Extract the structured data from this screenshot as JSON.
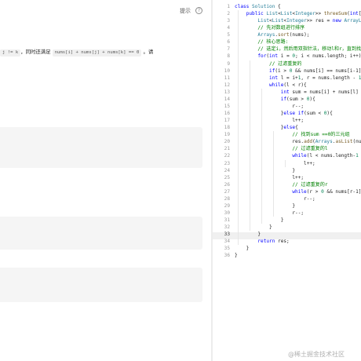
{
  "left": {
    "submit_label": "提示",
    "help_icon": "?",
    "desc_prefix": "j != k",
    "desc_middle": "，同时还满足",
    "desc_expr": "nums[i] + nums[j] + nums[k] == 0",
    "desc_suffix": "。请"
  },
  "editor": {
    "line_numbers": [
      "1",
      "2",
      "3",
      "4",
      "5",
      "6",
      "7",
      "8",
      "9",
      "10",
      "11",
      "12",
      "13",
      "14",
      "15",
      "16",
      "17",
      "18",
      "19",
      "20",
      "21",
      "22",
      "23",
      "24",
      "25",
      "26",
      "27",
      "28",
      "29",
      "30",
      "31",
      "32",
      "33",
      "34",
      "35",
      "36"
    ],
    "active_line": "33",
    "lines": [
      [
        {
          "t": "kw",
          "v": "class "
        },
        {
          "t": "type",
          "v": "Solution"
        },
        {
          "t": "pl",
          "v": " {"
        }
      ],
      [
        {
          "t": "pl",
          "v": "    "
        },
        {
          "t": "kw",
          "v": "public "
        },
        {
          "t": "type",
          "v": "List"
        },
        {
          "t": "pl",
          "v": "<"
        },
        {
          "t": "type",
          "v": "List"
        },
        {
          "t": "pl",
          "v": "<"
        },
        {
          "t": "type",
          "v": "Integer"
        },
        {
          "t": "pl",
          "v": ">> "
        },
        {
          "t": "fn",
          "v": "threeSum"
        },
        {
          "t": "pl",
          "v": "("
        },
        {
          "t": "kw",
          "v": "int"
        },
        {
          "t": "pl",
          "v": "[] nums) {"
        }
      ],
      [
        {
          "t": "pl",
          "v": "        "
        },
        {
          "t": "type",
          "v": "List"
        },
        {
          "t": "pl",
          "v": "<"
        },
        {
          "t": "type",
          "v": "List"
        },
        {
          "t": "pl",
          "v": "<"
        },
        {
          "t": "type",
          "v": "Integer"
        },
        {
          "t": "pl",
          "v": ">> res = "
        },
        {
          "t": "kw",
          "v": "new "
        },
        {
          "t": "type",
          "v": "ArrayList"
        },
        {
          "t": "pl",
          "v": "<>();"
        }
      ],
      [
        {
          "t": "pl",
          "v": "        "
        },
        {
          "t": "cm",
          "v": "// 先对数组进行排序"
        }
      ],
      [
        {
          "t": "pl",
          "v": "        "
        },
        {
          "t": "type",
          "v": "Arrays"
        },
        {
          "t": "pl",
          "v": "."
        },
        {
          "t": "fn",
          "v": "sort"
        },
        {
          "t": "pl",
          "v": "(nums);"
        }
      ],
      [
        {
          "t": "pl",
          "v": "        "
        },
        {
          "t": "cm",
          "v": "// 核心思路:"
        }
      ],
      [
        {
          "t": "pl",
          "v": "        "
        },
        {
          "t": "cm",
          "v": "// 选定i，然后用双指针法，移动l和r，直到找到"
        }
      ],
      [
        {
          "t": "pl",
          "v": "        "
        },
        {
          "t": "kw",
          "v": "for"
        },
        {
          "t": "pl",
          "v": "("
        },
        {
          "t": "kw",
          "v": "int "
        },
        {
          "t": "pl",
          "v": "i = "
        },
        {
          "t": "num",
          "v": "0"
        },
        {
          "t": "pl",
          "v": "; i < nums.length; i++){"
        }
      ],
      [
        {
          "t": "pl",
          "v": "            "
        },
        {
          "t": "cm",
          "v": "// 过滤重复的"
        }
      ],
      [
        {
          "t": "pl",
          "v": "            "
        },
        {
          "t": "kw",
          "v": "if"
        },
        {
          "t": "pl",
          "v": "(i > "
        },
        {
          "t": "num",
          "v": "0"
        },
        {
          "t": "pl",
          "v": " && nums[i] == nums[i-1]) "
        },
        {
          "t": "kw",
          "v": "continue"
        },
        {
          "t": "pl",
          "v": ";"
        }
      ],
      [
        {
          "t": "pl",
          "v": "            "
        },
        {
          "t": "kw",
          "v": "int "
        },
        {
          "t": "pl",
          "v": "l = i+"
        },
        {
          "t": "num",
          "v": "1"
        },
        {
          "t": "pl",
          "v": ", r = nums.length - "
        },
        {
          "t": "num",
          "v": "1"
        },
        {
          "t": "pl",
          "v": ";"
        }
      ],
      [
        {
          "t": "pl",
          "v": "            "
        },
        {
          "t": "kw",
          "v": "while"
        },
        {
          "t": "pl",
          "v": "(l < r){"
        }
      ],
      [
        {
          "t": "pl",
          "v": "                "
        },
        {
          "t": "kw",
          "v": "int "
        },
        {
          "t": "pl",
          "v": "sum = nums[i] + nums[l] + nums[r];"
        }
      ],
      [
        {
          "t": "pl",
          "v": "                "
        },
        {
          "t": "kw",
          "v": "if"
        },
        {
          "t": "pl",
          "v": "(sum > "
        },
        {
          "t": "num",
          "v": "0"
        },
        {
          "t": "pl",
          "v": "){"
        }
      ],
      [
        {
          "t": "pl",
          "v": "                    r--;"
        }
      ],
      [
        {
          "t": "pl",
          "v": "                }"
        },
        {
          "t": "kw",
          "v": "else if"
        },
        {
          "t": "pl",
          "v": "(sum < "
        },
        {
          "t": "num",
          "v": "0"
        },
        {
          "t": "pl",
          "v": "){"
        }
      ],
      [
        {
          "t": "pl",
          "v": "                    l++;"
        }
      ],
      [
        {
          "t": "pl",
          "v": "                }"
        },
        {
          "t": "kw",
          "v": "else"
        },
        {
          "t": "pl",
          "v": "{"
        }
      ],
      [
        {
          "t": "pl",
          "v": "                    "
        },
        {
          "t": "cm",
          "v": "// 找到sum ==0的三元组"
        }
      ],
      [
        {
          "t": "pl",
          "v": "                    res."
        },
        {
          "t": "fn",
          "v": "add"
        },
        {
          "t": "pl",
          "v": "("
        },
        {
          "t": "type",
          "v": "Arrays"
        },
        {
          "t": "pl",
          "v": "."
        },
        {
          "t": "fn",
          "v": "asList"
        },
        {
          "t": "pl",
          "v": "(nums[i], nums[l], nums[r]));"
        }
      ],
      [
        {
          "t": "pl",
          "v": "                    "
        },
        {
          "t": "cm",
          "v": "// 过滤重复的l"
        }
      ],
      [
        {
          "t": "pl",
          "v": "                    "
        },
        {
          "t": "kw",
          "v": "while"
        },
        {
          "t": "pl",
          "v": "(l < nums.length-"
        },
        {
          "t": "num",
          "v": "1"
        },
        {
          "t": "pl",
          "v": " && nums[l] == nums[l+1]){"
        }
      ],
      [
        {
          "t": "pl",
          "v": "                        l++;"
        }
      ],
      [
        {
          "t": "pl",
          "v": "                    }"
        }
      ],
      [
        {
          "t": "pl",
          "v": "                    l++;"
        }
      ],
      [
        {
          "t": "pl",
          "v": "                    "
        },
        {
          "t": "cm",
          "v": "// 过滤重复的r"
        }
      ],
      [
        {
          "t": "pl",
          "v": "                    "
        },
        {
          "t": "kw",
          "v": "while"
        },
        {
          "t": "pl",
          "v": "(r > "
        },
        {
          "t": "num",
          "v": "0"
        },
        {
          "t": "pl",
          "v": " && nums[r-1] == nums[r]){"
        }
      ],
      [
        {
          "t": "pl",
          "v": "                        r--;"
        }
      ],
      [
        {
          "t": "pl",
          "v": "                    }"
        }
      ],
      [
        {
          "t": "pl",
          "v": "                    r--;"
        }
      ],
      [
        {
          "t": "pl",
          "v": "                }"
        }
      ],
      [
        {
          "t": "pl",
          "v": "            }"
        }
      ],
      [
        {
          "t": "pl",
          "v": "        }"
        }
      ],
      [
        {
          "t": "pl",
          "v": "        "
        },
        {
          "t": "kw",
          "v": "return "
        },
        {
          "t": "pl",
          "v": "res;"
        }
      ],
      [
        {
          "t": "pl",
          "v": "    }"
        }
      ],
      [
        {
          "t": "pl",
          "v": "}"
        }
      ]
    ]
  },
  "watermark": "@稀土掘金技术社区"
}
